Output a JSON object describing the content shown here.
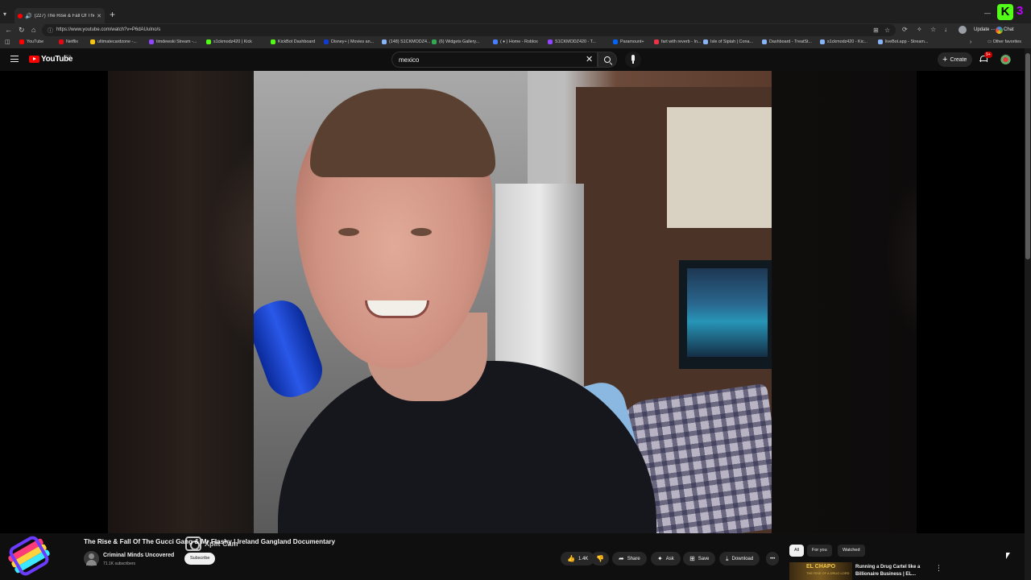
{
  "browser": {
    "tab_title": "(227) The Rise & Fall Of The",
    "url": "https://www.youtube.com/watch?v=P6dAUuIno/s",
    "update_label": "Update",
    "chat_label": "Chat",
    "icons": {
      "tab_dropdown": "chevron-down-icon",
      "back": "back-arrow-icon",
      "reload": "reload-icon",
      "home": "home-icon"
    },
    "bookmarks": [
      {
        "label": "YouTube",
        "color": "#ff0000"
      },
      {
        "label": "Netflix",
        "color": "#e50914"
      },
      {
        "label": "ultimatecardzone -...",
        "color": "#f5c518"
      },
      {
        "label": "timdewski Stream -...",
        "color": "#9146ff"
      },
      {
        "label": "s1ckmodz420 | Kick",
        "color": "#53fc18"
      },
      {
        "label": "KickBot Dashboard",
        "color": "#53fc18"
      },
      {
        "label": "Disney+ | Movies an...",
        "color": "#113ccf"
      },
      {
        "label": "(148) S1CKMODZ4...",
        "color": "#8ab4f8"
      },
      {
        "label": "(6) Widgets Gallery...",
        "color": "#34a853"
      },
      {
        "label": "( ♦ ) Home - Roblox",
        "color": "#4a7dff"
      },
      {
        "label": "S1CKMODZ420 - T...",
        "color": "#9146ff"
      },
      {
        "label": "Paramount+",
        "color": "#0064ff"
      },
      {
        "label": "fart with reverb - In...",
        "color": "#e34"
      },
      {
        "label": "Isle of Siptah | Cona...",
        "color": "#8ab4f8"
      },
      {
        "label": "Dashboard - TreatSt...",
        "color": "#8ab4f8"
      },
      {
        "label": "s1ckmodz420 - Kic...",
        "color": "#8ab4f8"
      },
      {
        "label": "liveBot.app - Stream...",
        "color": "#8ab4f8"
      }
    ],
    "other_favorites": "Other favorites"
  },
  "masthead": {
    "logo_text": "YouTube",
    "country": "CA",
    "search_value": "mexico",
    "create_label": "Create",
    "notifications_badge": "9+"
  },
  "video": {
    "title": "The Rise & Fall Of The Gucci Gang & Mr Flashy | Ireland Gangland Documentary",
    "watermark": "Xplit Cam",
    "channel_name": "Criminal Minds Uncovered",
    "subscribers": "71.1K subscribers",
    "subscribe_label": "Subscribe",
    "actions": {
      "likes": "1.4K",
      "share": "Share",
      "ask": "Ask",
      "save": "Save",
      "download": "Download",
      "more": "•••"
    }
  },
  "sidebar": {
    "chips": [
      "All",
      "For you",
      "Watched"
    ],
    "active_chip": "All",
    "recommendation": {
      "thumb_title": "EL CHAPO",
      "thumb_sub": "THE RISE OF A DRUG LORD",
      "title": "Running a Drug Cartel like a Billionaire Business | EL..."
    }
  }
}
